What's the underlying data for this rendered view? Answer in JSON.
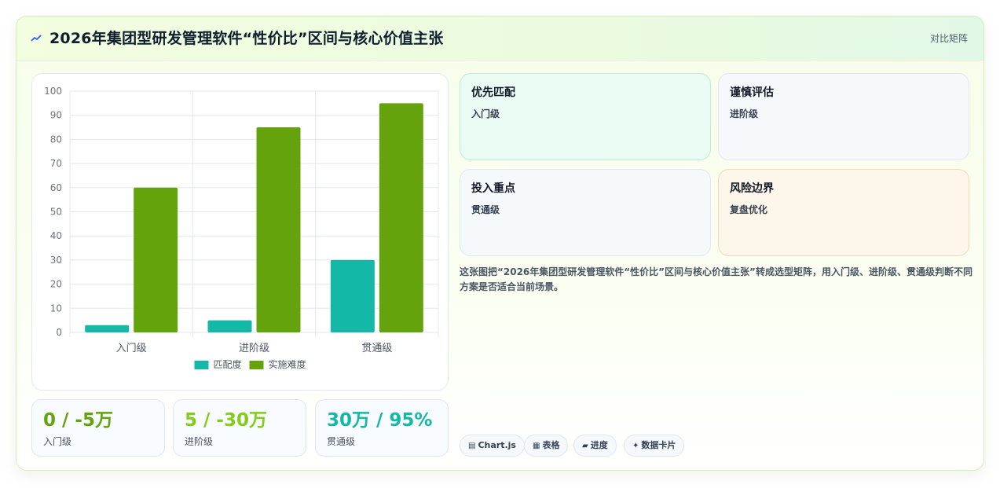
{
  "header": {
    "icon": "trend-icon",
    "title": "2026年集团型研发管理软件“性价比”区间与核心价值主张",
    "action_label": "对比矩阵"
  },
  "chart_data": {
    "type": "bar",
    "categories": [
      "入门级",
      "进阶级",
      "贯通级"
    ],
    "series": [
      {
        "name": "匹配度",
        "values": [
          3,
          5,
          30
        ],
        "color": "#14b8a6"
      },
      {
        "name": "实施难度",
        "values": [
          60,
          85,
          95
        ],
        "color": "#65a30d"
      }
    ],
    "ylim": [
      0,
      100
    ],
    "yticks": [
      0,
      10,
      20,
      30,
      40,
      50,
      60,
      70,
      80,
      90,
      100
    ],
    "grid": true,
    "legend": "bottom"
  },
  "stats": [
    {
      "value": "0 / -5万",
      "label": "入门级",
      "color": "#65a30d"
    },
    {
      "value": "5 / -30万",
      "label": "进阶级",
      "color": "#84cc16"
    },
    {
      "value": "30万 / 95%",
      "label": "贯通级",
      "color": "#14b8a6"
    }
  ],
  "quadrants": [
    {
      "title": "优先匹配",
      "sub": "入门级",
      "bg": "#e9fbf3",
      "border": "#bfecd6"
    },
    {
      "title": "谨慎评估",
      "sub": "进阶级",
      "bg": "#f6f9fc",
      "border": "#dfe7ef"
    },
    {
      "title": "投入重点",
      "sub": "贯通级",
      "bg": "#f6f9fc",
      "border": "#dfe7ef"
    },
    {
      "title": "风险边界",
      "sub": "复盘优化",
      "bg": "#fdf6ea",
      "border": "#f3d9b5"
    }
  ],
  "description": "这张图把“2026年集团型研发管理软件“性价比”区间与核心价值主张”转成选型矩阵，用入门级、进阶级、贯通级判断不同方案是否适合当前场景。",
  "chips": [
    {
      "icon": "▤",
      "label": "Chart.js"
    },
    {
      "icon": "▦",
      "label": "表格"
    },
    {
      "icon": "▰",
      "label": "进度"
    },
    {
      "icon": "✦",
      "label": "数据卡片"
    }
  ]
}
